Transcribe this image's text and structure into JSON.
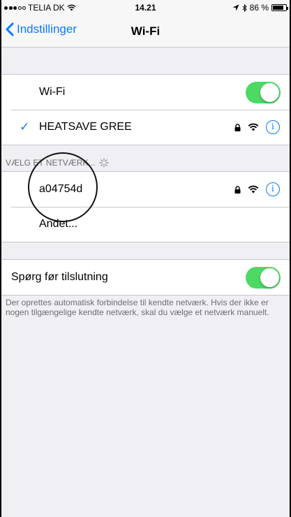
{
  "status_bar": {
    "carrier": "TELIA DK",
    "time": "14.21",
    "battery": "86 %",
    "battery_level": 0.86,
    "signal_bars_filled": 3,
    "signal_bars_total": 5
  },
  "nav": {
    "back_label": "Indstillinger",
    "title": "Wi-Fi"
  },
  "wifi_section": {
    "toggle_label": "Wi-Fi",
    "toggle_on": true,
    "connected_network": "HEATSAVE GREE"
  },
  "choose_section": {
    "header": "VÆLG ET NETVÆRK...",
    "networks": [
      {
        "name": "a04754d"
      }
    ],
    "other_label": "Andet..."
  },
  "ask_section": {
    "toggle_label": "Spørg før tilslutning",
    "toggle_on": true,
    "footer": "Der oprettes automatisk forbindelse til kendte netværk. Hvis der ikke er nogen tilgængelige kendte netværk, skal du vælge et netværk manuelt."
  },
  "colors": {
    "accent": "#0a7aff",
    "toggle_on": "#4cd964",
    "background": "#efeff4"
  }
}
